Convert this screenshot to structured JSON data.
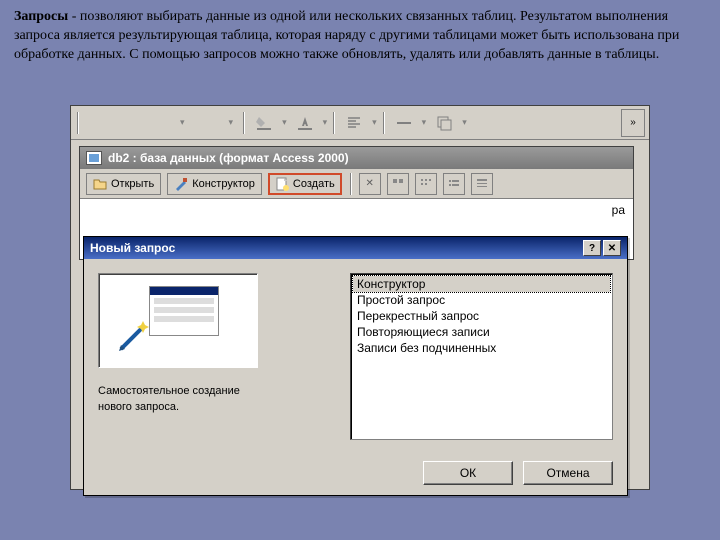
{
  "caption": {
    "term": "Запросы",
    "text": " - позволяют выбирать данные из одной или нескольких связанных таблиц. Результатом выполнения запроса является результирующая таблица, которая наряду с другими таблицами может быть использована при обработке данных. С помощью запросов можно также обновлять, удалять или добавлять данные в таблицы."
  },
  "dbwin": {
    "title": "db2 : база данных (формат Access 2000)",
    "open": "Открыть",
    "designer": "Конструктор",
    "create": "Создать",
    "rtxt": "ра"
  },
  "dialog": {
    "title": "Новый запрос",
    "desc1": "Самостоятельное создание",
    "desc2": "нового запроса.",
    "items": [
      "Конструктор",
      "Простой запрос",
      "Перекрестный запрос",
      "Повторяющиеся записи",
      "Записи без подчиненных"
    ],
    "ok": "ОК",
    "cancel": "Отмена"
  },
  "toolbar": {
    "overflow": "»"
  }
}
